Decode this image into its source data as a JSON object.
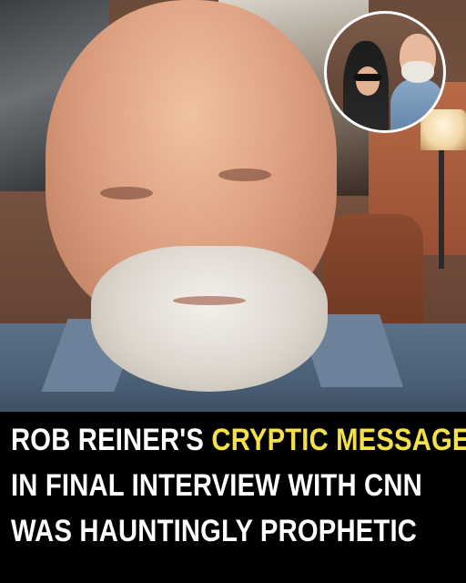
{
  "caption": {
    "line1_part1": "ROB REINER'S ",
    "line1_highlight": "CRYPTIC MESSAGE",
    "line2": "IN FINAL INTERVIEW WITH CNN",
    "line3": "WAS HAUNTINGLY PROPHETIC"
  },
  "colors": {
    "background": "#000000",
    "text": "#ffffff",
    "highlight": "#f3e04a",
    "inset_border": "#ffffff"
  }
}
